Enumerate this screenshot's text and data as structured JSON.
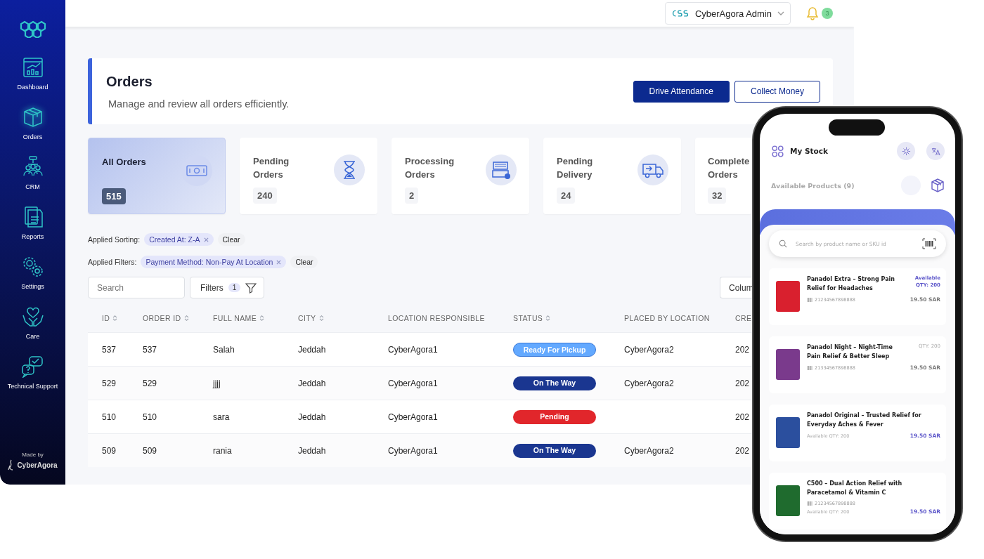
{
  "sidebar": {
    "items": [
      {
        "label": "Dashboard",
        "selected": false
      },
      {
        "label": "Orders",
        "selected": true
      },
      {
        "label": "CRM",
        "selected": false
      },
      {
        "label": "Reports",
        "selected": false
      },
      {
        "label": "Settings",
        "selected": false
      },
      {
        "label": "Care",
        "selected": false
      },
      {
        "label": "Technical Support",
        "selected": false
      }
    ],
    "footer": {
      "caption": "Made by",
      "brand": "CyberAgora"
    }
  },
  "topbar": {
    "account": "CyberAgora Admin",
    "notification_count": "3"
  },
  "header": {
    "title": "Orders",
    "subtitle": "Manage and review all orders efficiently.",
    "buttons": [
      {
        "label": "Drive Attendance",
        "kind": "primary"
      },
      {
        "label": "Collect Money",
        "kind": "outline"
      }
    ]
  },
  "stat_cards": [
    {
      "label": "All Orders",
      "count": "515",
      "selected": true
    },
    {
      "label": "Pending Orders",
      "count": "240",
      "selected": false
    },
    {
      "label": "Processing Orders",
      "count": "2",
      "selected": false
    },
    {
      "label": "Pending Delivery",
      "count": "24",
      "selected": false
    },
    {
      "label": "Complete Orders",
      "count": "32",
      "selected": false
    }
  ],
  "applied_sorting": {
    "label": "Applied Sorting:",
    "chips": [
      "Created At: Z-A"
    ],
    "clear": "Clear"
  },
  "applied_filters": {
    "label": "Applied Filters:",
    "chips": [
      "Payment Method: Non-Pay At Location"
    ],
    "clear": "Clear"
  },
  "toolbar": {
    "search_placeholder": "Search",
    "filters_label": "Filters",
    "filters_count": "1",
    "columns_label": "Colum"
  },
  "table": {
    "columns": [
      {
        "label": "ID",
        "sortable": true
      },
      {
        "label": "ORDER ID",
        "sortable": true
      },
      {
        "label": "FULL NAME",
        "sortable": true
      },
      {
        "label": "CITY",
        "sortable": true
      },
      {
        "label": "LOCATION RESPONSIBLE",
        "sortable": false
      },
      {
        "label": "STATUS",
        "sortable": true
      },
      {
        "label": "PLACED BY LOCATION",
        "sortable": false
      },
      {
        "label": "CRE",
        "sortable": false
      }
    ],
    "rows": [
      {
        "id": "537",
        "order_id": "537",
        "full_name": "Salah",
        "city": "Jeddah",
        "location_responsible": "CyberAgora1",
        "status": "Ready For Pickup",
        "kind": "ready",
        "placed_by_location": "CyberAgora2",
        "column_8": "202"
      },
      {
        "id": "529",
        "order_id": "529",
        "full_name": "jjjj",
        "city": "Jeddah",
        "location_responsible": "CyberAgora1",
        "status": "On The Way",
        "kind": "on_the_way",
        "placed_by_location": "CyberAgora2",
        "column_8": "202"
      },
      {
        "id": "510",
        "order_id": "510",
        "full_name": "sara",
        "city": "Jeddah",
        "location_responsible": "CyberAgora1",
        "status": "Pending",
        "kind": "pending",
        "column_8": "202"
      },
      {
        "id": "509",
        "order_id": "509",
        "full_name": "rania",
        "city": "Jeddah",
        "location_responsible": "CyberAgora1",
        "status": "On The Way",
        "kind": "on_the_way",
        "placed_by_location": "CyberAgora2",
        "column_8": "202"
      }
    ]
  },
  "phone": {
    "title": "My Stock",
    "available": "Available Products (9)",
    "search_placeholder": "Search by product name or SKU id",
    "products": [
      {
        "name": "Panadol Extra – Strong Pain Relief for Headaches",
        "barcode": "21234567898888",
        "qty": "Available QTY: 200",
        "kind": "top",
        "highlight_qty": true,
        "price": "19.50 SAR",
        "highlight_price": false,
        "color": "#d9202e"
      },
      {
        "name": "Panadol Night – Night-Time Pain Relief & Better Sleep",
        "barcode": "21334567898888",
        "qty": "QTY: 200",
        "kind": "top",
        "highlight_qty": false,
        "price": "19.50 SAR",
        "highlight_price": false,
        "color": "#7a3a8c"
      },
      {
        "name": "Panadol Original – Trusted Relief for Everyday Aches & Fever",
        "qty": "Available QTY: 200",
        "kind": "bottom",
        "highlight_qty": false,
        "price": "19.50 SAR",
        "highlight_price": true,
        "color": "#2b4f9e"
      },
      {
        "name": "C500 – Dual Action Relief with Paracetamol & Vitamin C",
        "barcode": "21234567898888",
        "qty": "Available QTY: 200",
        "kind": "bottom",
        "highlight_qty": false,
        "price": "19.50 SAR",
        "highlight_price": true,
        "color": "#1f6b2e"
      }
    ]
  }
}
